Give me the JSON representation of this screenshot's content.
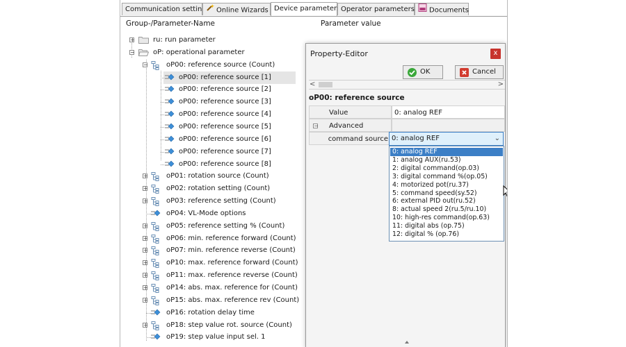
{
  "tabs": [
    {
      "label": "Communication settings",
      "icon": "none"
    },
    {
      "label": "Online Wizards",
      "icon": "wand-icon"
    },
    {
      "label": "Device parameters",
      "icon": "none",
      "active": true
    },
    {
      "label": "Operator parameters",
      "icon": "none"
    },
    {
      "label": "Documents",
      "icon": "pdf-icon"
    }
  ],
  "columns": {
    "name": "Group-/Parameter-Name",
    "value": "Parameter value"
  },
  "tree": [
    {
      "label": "ru: run parameter",
      "level": 0,
      "kind": "folder",
      "state": "collapsed"
    },
    {
      "label": "oP: operational parameter",
      "level": 0,
      "kind": "folder",
      "state": "expanded"
    },
    {
      "label": "oP00: reference source (Count)",
      "level": 1,
      "kind": "array",
      "state": "expanded"
    },
    {
      "label": "oP00: reference source [1]",
      "level": 2,
      "kind": "param",
      "selected": true
    },
    {
      "label": "oP00: reference source [2]",
      "level": 2,
      "kind": "param"
    },
    {
      "label": "oP00: reference source [3]",
      "level": 2,
      "kind": "param"
    },
    {
      "label": "oP00: reference source [4]",
      "level": 2,
      "kind": "param"
    },
    {
      "label": "oP00: reference source [5]",
      "level": 2,
      "kind": "param"
    },
    {
      "label": "oP00: reference source [6]",
      "level": 2,
      "kind": "param"
    },
    {
      "label": "oP00: reference source [7]",
      "level": 2,
      "kind": "param"
    },
    {
      "label": "oP00: reference source [8]",
      "level": 2,
      "kind": "param"
    },
    {
      "label": "oP01: rotation source (Count)",
      "level": 1,
      "kind": "array",
      "state": "collapsed"
    },
    {
      "label": "oP02: rotation setting (Count)",
      "level": 1,
      "kind": "array",
      "state": "collapsed"
    },
    {
      "label": "oP03: reference setting (Count)",
      "level": 1,
      "kind": "array",
      "state": "collapsed"
    },
    {
      "label": "oP04: VL-Mode options",
      "level": 1,
      "kind": "param"
    },
    {
      "label": "oP05: reference setting % (Count)",
      "level": 1,
      "kind": "array",
      "state": "collapsed"
    },
    {
      "label": "oP06: min. reference forward (Count)",
      "level": 1,
      "kind": "array",
      "state": "collapsed"
    },
    {
      "label": "oP07: min. reference reverse (Count)",
      "level": 1,
      "kind": "array",
      "state": "collapsed"
    },
    {
      "label": "oP10: max. reference forward (Count)",
      "level": 1,
      "kind": "array",
      "state": "collapsed"
    },
    {
      "label": "oP11: max. reference reverse (Count)",
      "level": 1,
      "kind": "array",
      "state": "collapsed"
    },
    {
      "label": "oP14: abs. max. reference for (Count)",
      "level": 1,
      "kind": "array",
      "state": "collapsed"
    },
    {
      "label": "oP15: abs. max. reference rev (Count)",
      "level": 1,
      "kind": "array",
      "state": "collapsed"
    },
    {
      "label": "oP16: rotation delay time",
      "level": 1,
      "kind": "param"
    },
    {
      "label": "oP18: step value rot. source (Count)",
      "level": 1,
      "kind": "array",
      "state": "collapsed"
    },
    {
      "label": "oP19: step value input sel. 1",
      "level": 1,
      "kind": "param"
    }
  ],
  "property_editor": {
    "title": "Property-Editor",
    "close_label": "x",
    "ok_label": "OK",
    "cancel_label": "Cancel",
    "heading": "oP00: reference source",
    "value_label": "Value",
    "value": "0: analog REF",
    "advanced_label": "Advanced",
    "advanced_toggle": "−",
    "command_source_label": "command source",
    "command_source_value": "0: analog REF",
    "options": [
      "0: analog REF",
      "1: analog AUX(ru.53)",
      "2: digital command(op.03)",
      "3: digital command %(op.05)",
      "4: motorized pot(ru.37)",
      "5: command speed(sy.52)",
      "6: external PID out(ru.52)",
      "8: actual speed 2(ru.5/ru.10)",
      "10: high-res command(op.63)",
      "11: digital abs (op.75)",
      "12: digital % (op.76)"
    ],
    "selected_option_index": 0
  },
  "colors": {
    "accent": "#3c7fc6",
    "close": "#c7332d",
    "ok_icon": "#3aa83a",
    "cancel_icon": "#d23b2f"
  }
}
